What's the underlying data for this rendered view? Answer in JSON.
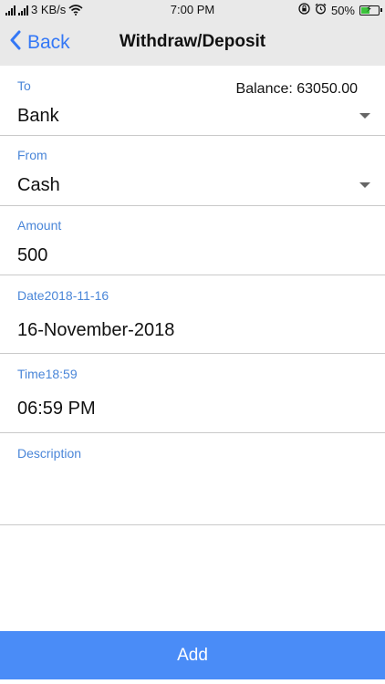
{
  "status_bar": {
    "network_speed": "3 KB/s",
    "time": "7:00 PM",
    "battery_percent": "50%",
    "battery_level": 0.5,
    "icons": [
      "signal-icon",
      "wifi-icon",
      "rotation-lock-icon",
      "alarm-icon",
      "battery-icon"
    ]
  },
  "nav": {
    "back_label": "Back",
    "title": "Withdraw/Deposit"
  },
  "form": {
    "to": {
      "label": "To",
      "value": "Bank",
      "balance": "Balance: 63050.00"
    },
    "from": {
      "label": "From",
      "value": "Cash"
    },
    "amount": {
      "label": "Amount",
      "value": "500"
    },
    "date": {
      "label": "Date2018-11-16",
      "value": "16-November-2018"
    },
    "time": {
      "label": "Time18:59",
      "value": "06:59 PM"
    },
    "description": {
      "label": "Description",
      "value": ""
    }
  },
  "add_button_label": "Add",
  "colors": {
    "accent": "#3478f6",
    "label": "#4a86d8",
    "button": "#4a8cf7",
    "bar_bg": "#e9e9e9",
    "battery": "#3cc43c"
  }
}
